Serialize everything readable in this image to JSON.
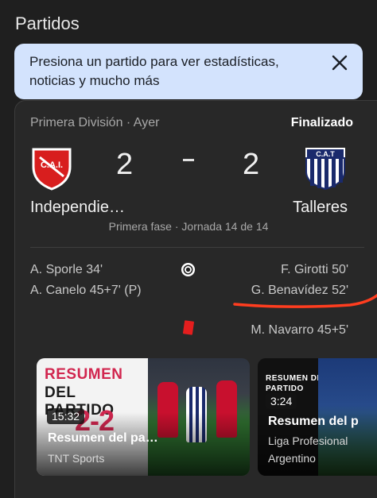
{
  "section": {
    "title": "Partidos"
  },
  "tip": {
    "text": "Presiona un partido para ver estadísticas, noticias y mucho más",
    "close_icon": "close-icon"
  },
  "match": {
    "competition": "Primera División · Ayer",
    "status": "Finalizado",
    "home": {
      "name": "Independie…",
      "score": "2",
      "crest_text": "C.A.I.",
      "color": "#d81e1e"
    },
    "away": {
      "name": "Talleres",
      "score": "2",
      "crest_text": "C.A.T",
      "color": "#1a2a6c"
    },
    "phase": "Primera fase · Jornada 14 de 14",
    "goals_home": [
      "A. Sporle 34'",
      "A. Canelo 45+7' (P)"
    ],
    "goals_away": [
      "F. Girotti 50'",
      "G. Benavídez 52'"
    ],
    "red_cards_away": [
      "M. Navarro 45+5'"
    ],
    "icons": {
      "goal": "soccer-ball-icon",
      "card": "red-card-icon"
    }
  },
  "annotation": {
    "color": "#ff3d1f"
  },
  "videos": [
    {
      "thumb_heading_1": "RESUMEN",
      "thumb_heading_2": "DEL PARTIDO",
      "thumb_score": "2-2",
      "duration": "15:32",
      "title": "Resumen del pa…",
      "source": "TNT Sports"
    },
    {
      "thumb_heading_1": "RESUMEN DEL",
      "thumb_heading_2": "PARTIDO",
      "duration": "3:24",
      "title": "Resumen del p",
      "source_line1": "Liga Profesional",
      "source_line2": "Argentino"
    }
  ]
}
